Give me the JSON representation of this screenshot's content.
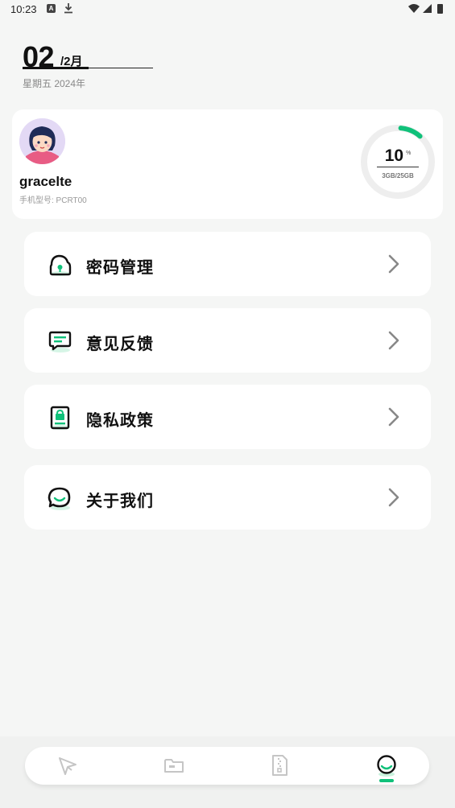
{
  "status_bar": {
    "time": "10:23",
    "notification_icons": [
      "a-icon",
      "download-icon"
    ],
    "system_icons": [
      "wifi-icon",
      "signal-icon",
      "battery-icon"
    ]
  },
  "date": {
    "day": "02",
    "month": "/2月",
    "weekday_year": "星期五  2024年"
  },
  "profile": {
    "username": "gracelte",
    "device_model": "手机型号: PCRT00",
    "storage": {
      "percent": "10",
      "percent_sign": "%",
      "used_total": "3GB/25GB",
      "fraction": 0.1
    }
  },
  "menu": [
    {
      "label": "密码管理",
      "icon": "lock-cloud-icon"
    },
    {
      "label": "意见反馈",
      "icon": "feedback-icon"
    },
    {
      "label": "隐私政策",
      "icon": "privacy-doc-icon"
    },
    {
      "label": "关于我们",
      "icon": "chat-bubble-icon"
    }
  ],
  "bottom_nav": {
    "tabs": [
      {
        "icon": "send-icon",
        "active": false
      },
      {
        "icon": "folder-icon",
        "active": false
      },
      {
        "icon": "zip-file-icon",
        "active": false
      },
      {
        "icon": "profile-icon",
        "active": true
      }
    ]
  },
  "colors": {
    "accent": "#10c17a",
    "background": "#f5f6f5",
    "card": "#ffffff",
    "ring_track": "#eeeeee"
  }
}
